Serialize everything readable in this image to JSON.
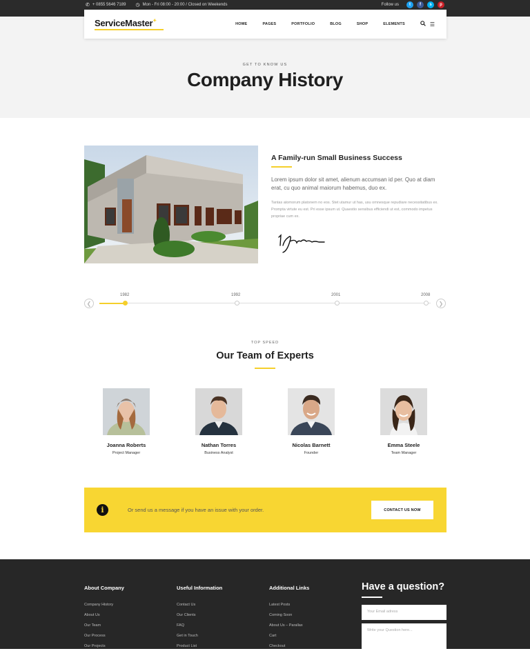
{
  "topbar": {
    "phone": "+ 0855 5646 7189",
    "hours": "Mon - Fri 08:00 - 20:00 / Closed on Weekends",
    "follow": "Follow us",
    "social": [
      {
        "icon": "twitter-icon",
        "glyph": "t",
        "color": "#1da1f2"
      },
      {
        "icon": "facebook-icon",
        "glyph": "f",
        "color": "#3b5998"
      },
      {
        "icon": "skype-icon",
        "glyph": "s",
        "color": "#00aff0"
      },
      {
        "icon": "pinterest-icon",
        "glyph": "p",
        "color": "#cb2027"
      }
    ]
  },
  "header": {
    "logo": "ServiceMaster",
    "nav": [
      "HOME",
      "PAGES",
      "PORTFOLIO",
      "BLOG",
      "SHOP",
      "ELEMENTS"
    ]
  },
  "hero": {
    "eyebrow": "GET TO KNOW US",
    "title": "Company History"
  },
  "about": {
    "heading": "A Family-run Small Business Success",
    "lead": "Lorem ipsum dolor sit amet, alienum accumsan id per. Quo at diam erat, cu quo animal maiorum habemus, duo ex.",
    "body": "Tantas atomorum platonem no eos. Stet utamur ut has, usu omnesque repudiare necessitatibus ex. Prompta virtute eu est. Pri esse ipsum ut. Quaestio sensibus efficiendi ut est, commodo impetus propriae cum ex."
  },
  "timeline": {
    "years": [
      "1982",
      "1992",
      "2001",
      "2008"
    ],
    "active_index": 0
  },
  "team": {
    "eyebrow": "TOP SPEED",
    "title": "Our Team of Experts",
    "members": [
      {
        "name": "Joanna Roberts",
        "role": "Project Manager"
      },
      {
        "name": "Nathan Torres",
        "role": "Business Analyst"
      },
      {
        "name": "Nicolas Barnett",
        "role": "Founder"
      },
      {
        "name": "Emma Steele",
        "role": "Team Manager"
      }
    ]
  },
  "cta": {
    "text": "Or send us a message if you have an issue with your order.",
    "button": "CONTACT US NOW"
  },
  "footer": {
    "columns": [
      {
        "title": "About Company",
        "links": [
          "Company History",
          "About Us",
          "Our Team",
          "Our Process",
          "Our Projects"
        ]
      },
      {
        "title": "Useful Information",
        "links": [
          "Contact Us",
          "Our Clients",
          "FAQ",
          "Get in Touch",
          "Product List"
        ]
      },
      {
        "title": "Additional Links",
        "links": [
          "Latest Posts",
          "Coming Soon",
          "About Us – Parallax",
          "Cart",
          "Checkout"
        ]
      }
    ],
    "question_title": "Have a question?",
    "email_placeholder": "Your Email adress",
    "question_placeholder": "Write your Question here..."
  },
  "colors": {
    "accent": "#f5cf2a",
    "dark": "#272727"
  }
}
